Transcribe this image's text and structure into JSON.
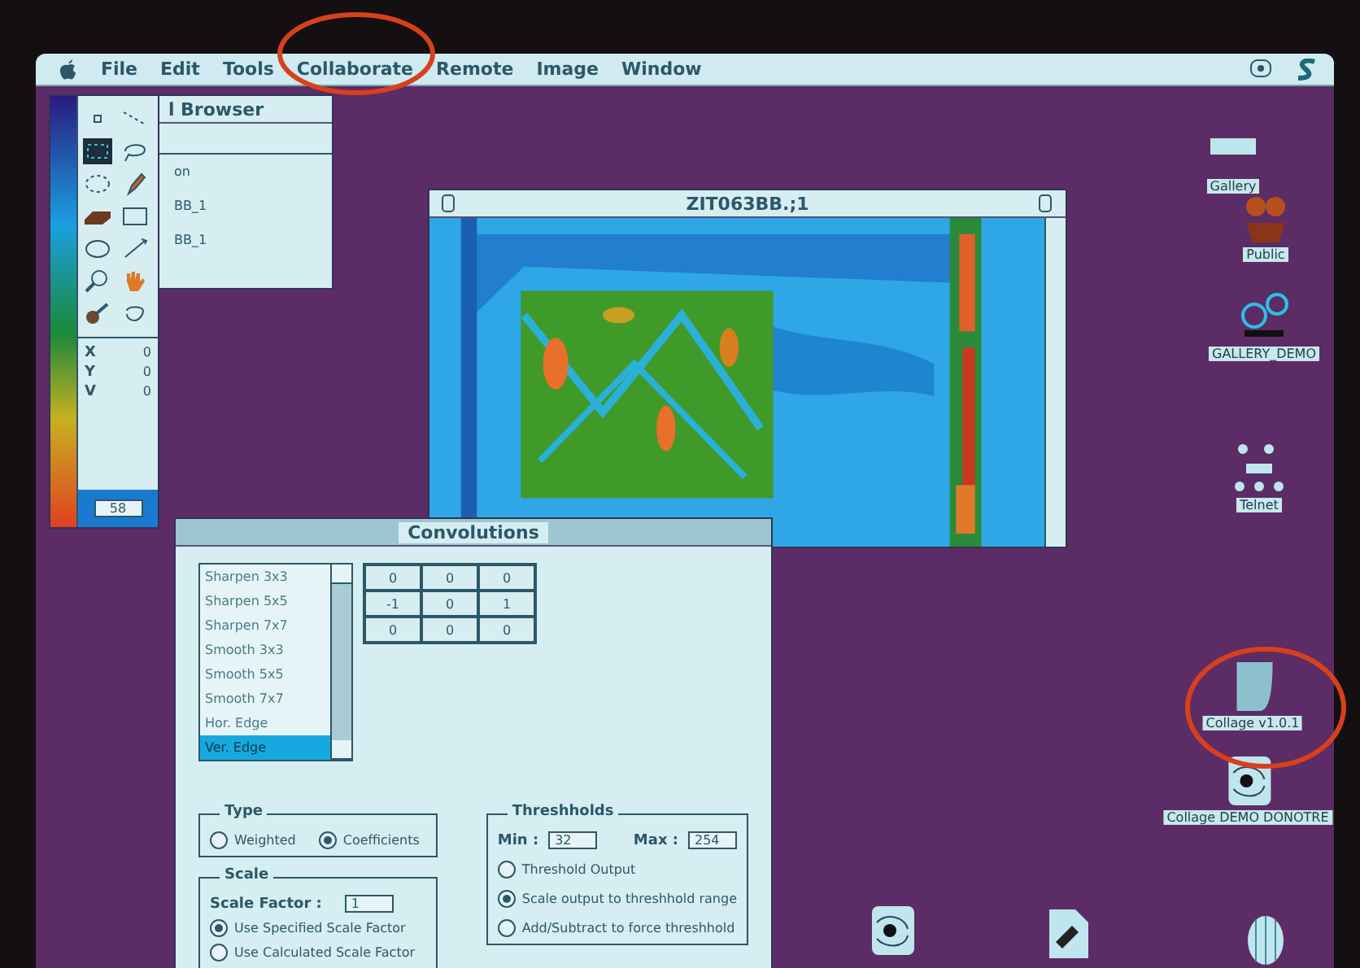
{
  "menu_bar": {
    "items": [
      "File",
      "Edit",
      "Tools",
      "Collaborate",
      "Remote",
      "Image",
      "Window"
    ]
  },
  "browser_window": {
    "title": "l Browser",
    "items": [
      "on",
      "BB_1",
      "BB_1"
    ]
  },
  "tool_palette": {
    "readouts": [
      {
        "label": "X",
        "value": "0"
      },
      {
        "label": "Y",
        "value": "0"
      },
      {
        "label": "V",
        "value": "0"
      }
    ],
    "field": "58"
  },
  "image_window": {
    "title": "ZIT063BB.;1"
  },
  "convolutions": {
    "title": "Convolutions",
    "filters": [
      {
        "label": "Sharpen 3x3",
        "selected": false
      },
      {
        "label": "Sharpen 5x5",
        "selected": false
      },
      {
        "label": "Sharpen 7x7",
        "selected": false
      },
      {
        "label": "Smooth 3x3",
        "selected": false
      },
      {
        "label": "Smooth 5x5",
        "selected": false
      },
      {
        "label": "Smooth 7x7",
        "selected": false
      },
      {
        "label": "Hor. Edge",
        "selected": false
      },
      {
        "label": "Ver. Edge",
        "selected": true
      }
    ],
    "matrix": [
      [
        "0",
        "0",
        "0"
      ],
      [
        "-1",
        "0",
        "1"
      ],
      [
        "0",
        "0",
        "0"
      ]
    ],
    "type": {
      "title": "Type",
      "options": [
        {
          "label": "Weighted",
          "selected": false
        },
        {
          "label": "Coefficients",
          "selected": true
        }
      ]
    },
    "scale": {
      "title": "Scale",
      "factor_label": "Scale Factor :",
      "factor": "1",
      "options": [
        {
          "label": "Use Specified Scale Factor",
          "selected": true
        },
        {
          "label": "Use Calculated Scale Factor",
          "selected": false
        }
      ]
    },
    "thresholds": {
      "title": "Threshholds",
      "min_label": "Min :",
      "min": "32",
      "max_label": "Max :",
      "max": "254",
      "options": [
        {
          "label": "Threshold Output",
          "selected": false
        },
        {
          "label": "Scale output to threshhold range",
          "selected": true
        },
        {
          "label": "Add/Subtract to force threshhold",
          "selected": false
        }
      ]
    }
  },
  "desktop_icons": [
    {
      "label": "Gallery",
      "kind": "drive"
    },
    {
      "label": "Public",
      "kind": "people"
    },
    {
      "label": "GALLERY_DEMO",
      "kind": "reels"
    },
    {
      "label": "Telnet",
      "kind": "network"
    },
    {
      "label": "Collage v1.0.1",
      "kind": "app"
    },
    {
      "label": "Collage DEMO DONOTRE",
      "kind": "spiral"
    }
  ],
  "bottom_icons": [
    {
      "kind": "spiral"
    },
    {
      "kind": "sketch"
    },
    {
      "kind": "barrel"
    }
  ]
}
